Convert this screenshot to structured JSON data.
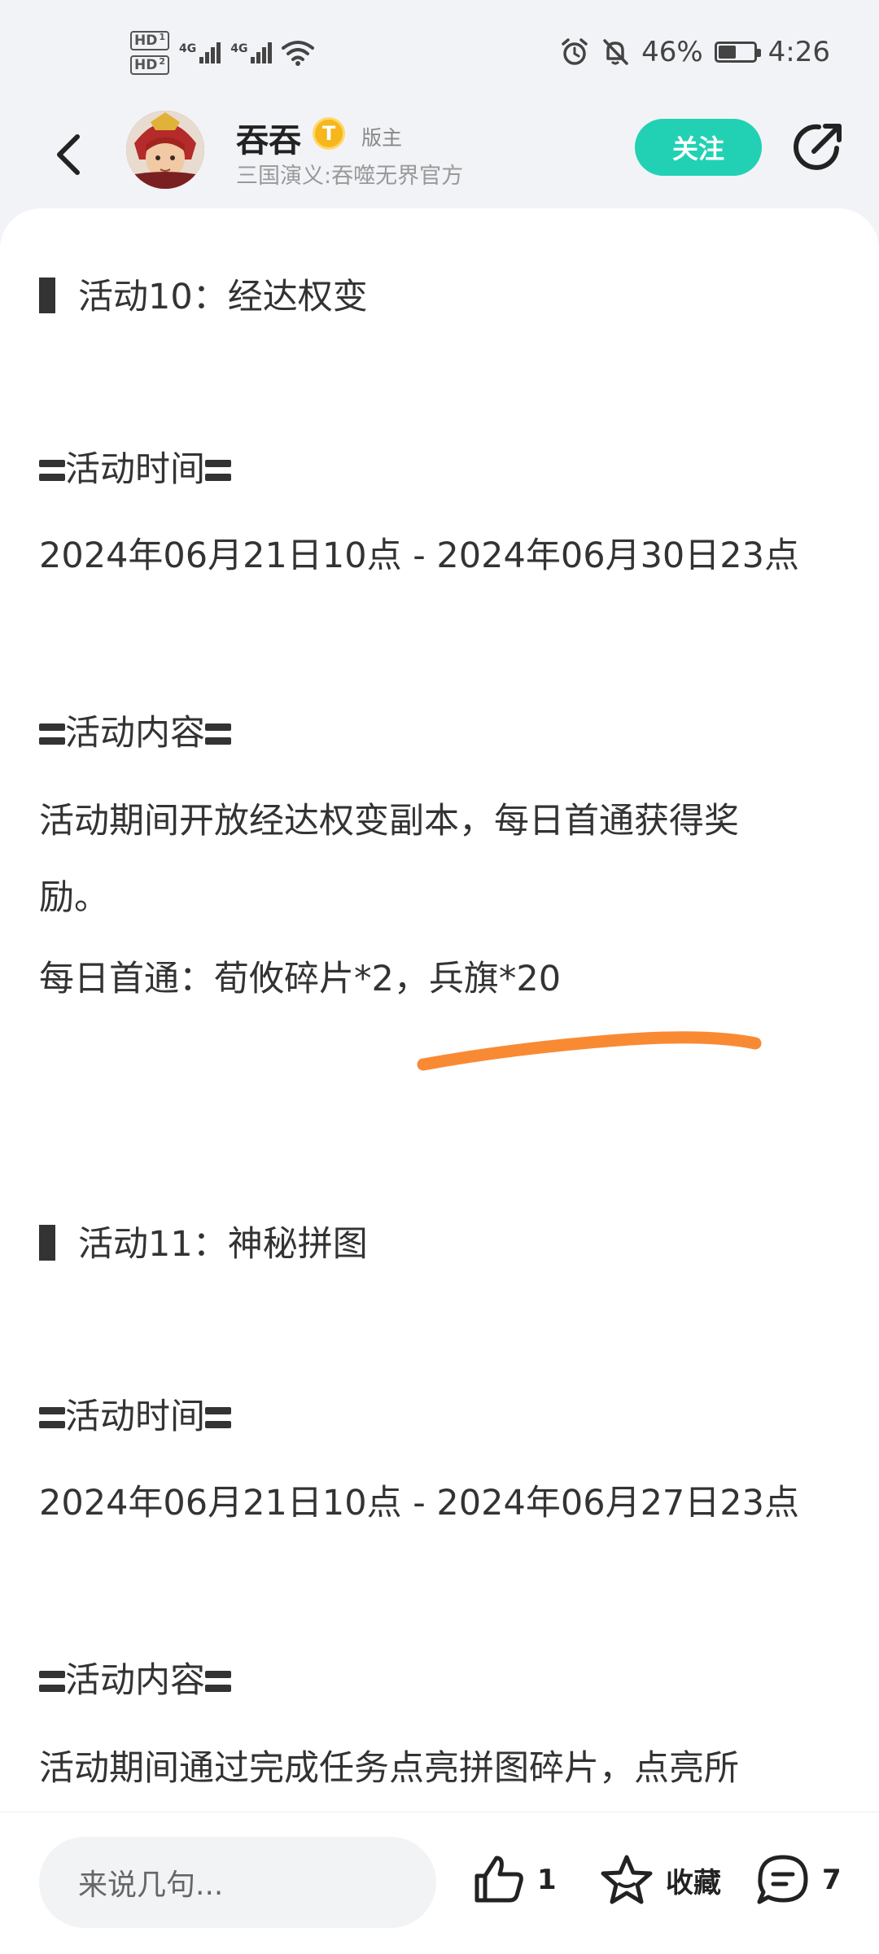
{
  "status_bar": {
    "hd1": "HD",
    "hd1_sub": "1",
    "hd2": "HD",
    "hd2_sub": "2",
    "net1": "4G",
    "net2": "4G",
    "battery_percent": "46%",
    "battery_level": 0.46,
    "time": "4:26"
  },
  "header": {
    "user_name": "吞吞",
    "badge": "T",
    "role": "版主",
    "user_sub": "三国演义:吞噬无界官方",
    "follow_label": "关注"
  },
  "post": {
    "activity10_title": "活动10：经达权变",
    "activity10_time_heading": "活动时间",
    "activity10_time": "2024年06月21日10点 - 2024年06月30日23点",
    "activity10_content_heading": "活动内容",
    "activity10_desc_line1": "活动期间开放经达权变副本，每日首通获得奖",
    "activity10_desc_line2": "励。",
    "activity10_reward": "每日首通：荀攸碎片*2，兵旗*20",
    "activity11_title": "活动11：神秘拼图",
    "activity11_time_heading": "活动时间",
    "activity11_time": "2024年06月21日10点 - 2024年06月27日23点",
    "activity11_content_heading": "活动内容",
    "activity11_desc_line1": "活动期间通过完成任务点亮拼图碎片，点亮所"
  },
  "bottom_bar": {
    "comment_placeholder": "来说几句...",
    "like_count": "1",
    "favorite_label": "收藏",
    "comment_count": "7"
  },
  "colors": {
    "accent": "#22d1b3",
    "highlight_stroke": "#f98a34",
    "badge": "#f6b61c"
  }
}
